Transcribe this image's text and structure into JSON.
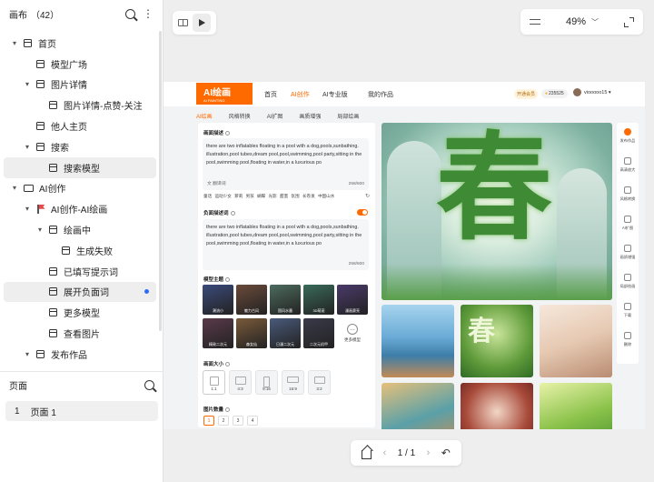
{
  "layers_panel": {
    "title": "画布",
    "count": "（42）",
    "tree": [
      {
        "label": "首页",
        "depth": 0,
        "caret": "▾",
        "icon": "page"
      },
      {
        "label": "模型广场",
        "depth": 1,
        "caret": "",
        "icon": "page"
      },
      {
        "label": "图片详情",
        "depth": 1,
        "caret": "▾",
        "icon": "page"
      },
      {
        "label": "图片详情-点赞-关注",
        "depth": 2,
        "caret": "",
        "icon": "page"
      },
      {
        "label": "他人主页",
        "depth": 1,
        "caret": "",
        "icon": "page"
      },
      {
        "label": "搜索",
        "depth": 1,
        "caret": "▾",
        "icon": "page"
      },
      {
        "label": "搜索模型",
        "depth": 2,
        "caret": "",
        "icon": "page",
        "selected": true
      },
      {
        "label": "AI创作",
        "depth": 0,
        "caret": "▾",
        "icon": "folder"
      },
      {
        "label": "AI创作-AI绘画",
        "depth": 1,
        "caret": "▾",
        "icon": "flag"
      },
      {
        "label": "绘画中",
        "depth": 2,
        "caret": "▾",
        "icon": "page"
      },
      {
        "label": "生成失败",
        "depth": 3,
        "caret": "",
        "icon": "page"
      },
      {
        "label": "已填写提示词",
        "depth": 2,
        "caret": "",
        "icon": "page"
      },
      {
        "label": "展开负面词",
        "depth": 2,
        "caret": "",
        "icon": "page",
        "selected": true,
        "dot": true
      },
      {
        "label": "更多模型",
        "depth": 2,
        "caret": "",
        "icon": "page"
      },
      {
        "label": "查看图片",
        "depth": 2,
        "caret": "",
        "icon": "page"
      },
      {
        "label": "发布作品",
        "depth": 1,
        "caret": "▾",
        "icon": "page"
      }
    ]
  },
  "pages_panel": {
    "title": "页面",
    "items": [
      {
        "index": "1",
        "label": "页面 1"
      }
    ]
  },
  "toolbar": {
    "zoom": "49%"
  },
  "pager": {
    "text": "1 / 1"
  },
  "site": {
    "logo": "AI绘画",
    "logo_sub": "AI PAINTING",
    "nav": [
      "首页",
      "AI创作",
      "AI专业版",
      "我的作品"
    ],
    "vip": "开通会员",
    "coins": "235525",
    "username": "viooooo15 ▾",
    "sub_tabs": [
      "AI绘画",
      "风格转换",
      "AI扩图",
      "画质增强",
      "局部绘画"
    ],
    "prompt_label": "画面描述",
    "prompt_text": "there are two inflatables floating in a pool with a dog,pools,sunbathing. illustration,pool tubes,dream pool,pool,swimming,pool party,sitting in the pool,swimming pool,floating in water,in a luxurious po",
    "prompt_count": "258/600",
    "translate": "文 翻译词",
    "tags": "童话  运动少女  萝莉  男孩  蝴蝶  光影  甜蜜  氛围  长卷发  中国山水",
    "negative_label": "负面描述词",
    "negative_text": "there are two inflatables floating in a pool with a dog,pools,sunbathing. illustration,pool tubes,dream pool,pool,swimming,pool party,sitting in the pool,swimming pool,floating in water,in a luxurious po",
    "negative_count": "258/600",
    "model_label": "模型主题",
    "models": [
      {
        "name": "潮流小",
        "color": "#3b4a7a"
      },
      {
        "name": "魅力古风",
        "color": "#6a4a3a"
      },
      {
        "name": "国风水墨",
        "color": "#4d6b5e"
      },
      {
        "name": "3D萌宠",
        "color": "#3a6a5a"
      },
      {
        "name": "漫画赛亮",
        "color": "#4a3a6a"
      },
      {
        "name": "精致二次元",
        "color": "#5a3a4a"
      },
      {
        "name": "森女仙",
        "color": "#7a5a3a"
      },
      {
        "name": "日漫二次元",
        "color": "#4a5a7a"
      },
      {
        "name": "二次元机甲",
        "color": "#3a3a4a"
      }
    ],
    "more_models": "更多模型",
    "size_label": "画面大小",
    "sizes": [
      "1:1",
      "4:3",
      "9:16",
      "16:9",
      "3:2"
    ],
    "count_label": "图片数量",
    "counts": [
      "1",
      "2",
      "3",
      "4"
    ],
    "tools": [
      "发布作品",
      "高清放大",
      "风格转换",
      "AI扩图",
      "画质增强",
      "局部绘画",
      "下载",
      "删除"
    ]
  }
}
